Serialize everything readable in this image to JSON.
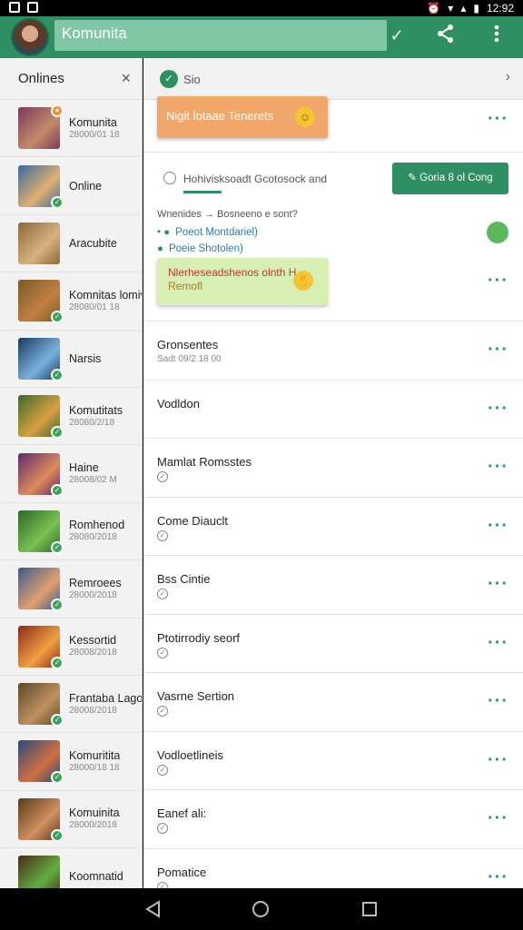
{
  "status_bar": {
    "time": "12:92"
  },
  "app_bar": {
    "title": "Komunita",
    "title_check": "✓"
  },
  "left": {
    "header": "Onlines",
    "close": "×",
    "contacts": [
      {
        "name": "Komunita",
        "sub": "28000/01 18",
        "colors": [
          "#7a3a5a",
          "#c48a6a"
        ],
        "badge": "top"
      },
      {
        "name": "Online",
        "sub": "",
        "colors": [
          "#3a6aa0",
          "#e0b070"
        ],
        "badge": "bottom"
      },
      {
        "name": "Aracubite",
        "sub": "",
        "colors": [
          "#8a6a3a",
          "#d8b080"
        ],
        "badge": ""
      },
      {
        "name": "Komnitas lomivantni",
        "sub": "28080/01 18",
        "colors": [
          "#7a5a2a",
          "#c08040"
        ],
        "badge": "bottom"
      },
      {
        "name": "Narsis",
        "sub": "",
        "colors": [
          "#1a3a5a",
          "#7ab0e0"
        ],
        "badge": "bottom"
      },
      {
        "name": "Komutitats",
        "sub": "28080/2/18",
        "colors": [
          "#3a6a2a",
          "#d8a040"
        ],
        "badge": "bottom"
      },
      {
        "name": "Haine",
        "sub": "28008/02 M",
        "colors": [
          "#5a2a6a",
          "#e08a5a"
        ],
        "badge": "bottom"
      },
      {
        "name": "Romhenod",
        "sub": "28080/2018",
        "colors": [
          "#2a6a2a",
          "#7ac050"
        ],
        "badge": "bottom"
      },
      {
        "name": "Remroees",
        "sub": "28000/2018",
        "colors": [
          "#3a5a8a",
          "#e0a070"
        ],
        "badge": "bottom"
      },
      {
        "name": "Kessortid",
        "sub": "28008/2018",
        "colors": [
          "#8a2a1a",
          "#f0a040"
        ],
        "badge": "bottom"
      },
      {
        "name": "Frantaba Lagoone",
        "sub": "28008/2018",
        "colors": [
          "#5a4a2a",
          "#c09060"
        ],
        "badge": "bottom"
      },
      {
        "name": "Komuritita",
        "sub": "28000/18 18",
        "colors": [
          "#2a4a7a",
          "#d07040"
        ],
        "badge": "bottom"
      },
      {
        "name": "Komuinita",
        "sub": "28000/2018",
        "colors": [
          "#5a3a1a",
          "#d09060"
        ],
        "badge": "bottom"
      },
      {
        "name": "Koomnatid",
        "sub": "",
        "colors": [
          "#4a2a1a",
          "#60b040"
        ],
        "badge": ""
      }
    ]
  },
  "right": {
    "header": {
      "label": "Sio",
      "chevron": "›"
    },
    "toast_orange": "Nigit lotaae Tenerets",
    "option_label": "Hohivisksoadt Gcotosock and",
    "go_button": "Goria 8 ol Cong",
    "question": "Wnenides → Bosneeno e sont?",
    "options": [
      "Poeot Montdariel)",
      "Poeie Shotolen)"
    ],
    "toast_green_line1": "Nlerheseadshenos olnth H",
    "toast_green_line2": "Remofl",
    "rows": [
      {
        "title": "Gronsentes",
        "sub": "Sadt 09/2 18 00"
      },
      {
        "title": "Vodldon",
        "sub": ""
      },
      {
        "title": "Mamlat Romsstes",
        "sub": ""
      },
      {
        "title": "Come Diauclt",
        "sub": ""
      },
      {
        "title": "Bss Cintie",
        "sub": ""
      },
      {
        "title": "Ptotirrodiy seorf",
        "sub": ""
      },
      {
        "title": "Vasrne Sertion",
        "sub": ""
      },
      {
        "title": "Vodloetlineis",
        "sub": ""
      },
      {
        "title": "Eanef ali:",
        "sub": ""
      },
      {
        "title": "Pomatice",
        "sub": ""
      }
    ]
  },
  "colors": {
    "primary": "#2e8f63",
    "accent_orange": "#f1a66a",
    "accent_green": "#d8efb4"
  }
}
